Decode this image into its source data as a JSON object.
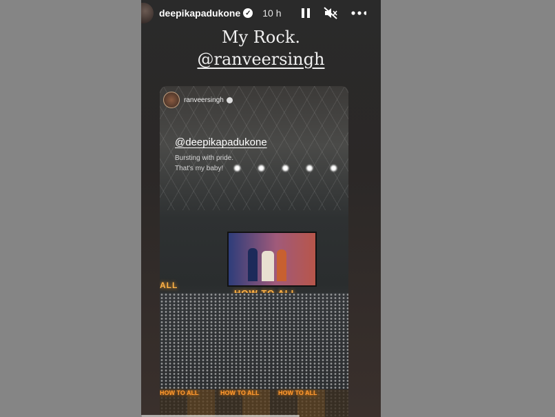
{
  "story": {
    "username": "deepikapadukone",
    "time": "10 h",
    "caption_line1": "My Rock.",
    "caption_line2": "@ranveersingh",
    "controls": {
      "pause_icon": "pause-icon",
      "mute_icon": "muted-speaker-icon",
      "more_icon": "more-icon"
    }
  },
  "shared_post": {
    "username": "ranveersingh",
    "mention": "@deepikapadukone",
    "note_line1": "Bursting with pride.",
    "note_line2": "That's my baby!",
    "arena_sign": "HOW TO ALL",
    "low_signs": [
      "HOW TO ALL",
      "HOW TO ALL",
      "HOW TO ALL"
    ]
  }
}
